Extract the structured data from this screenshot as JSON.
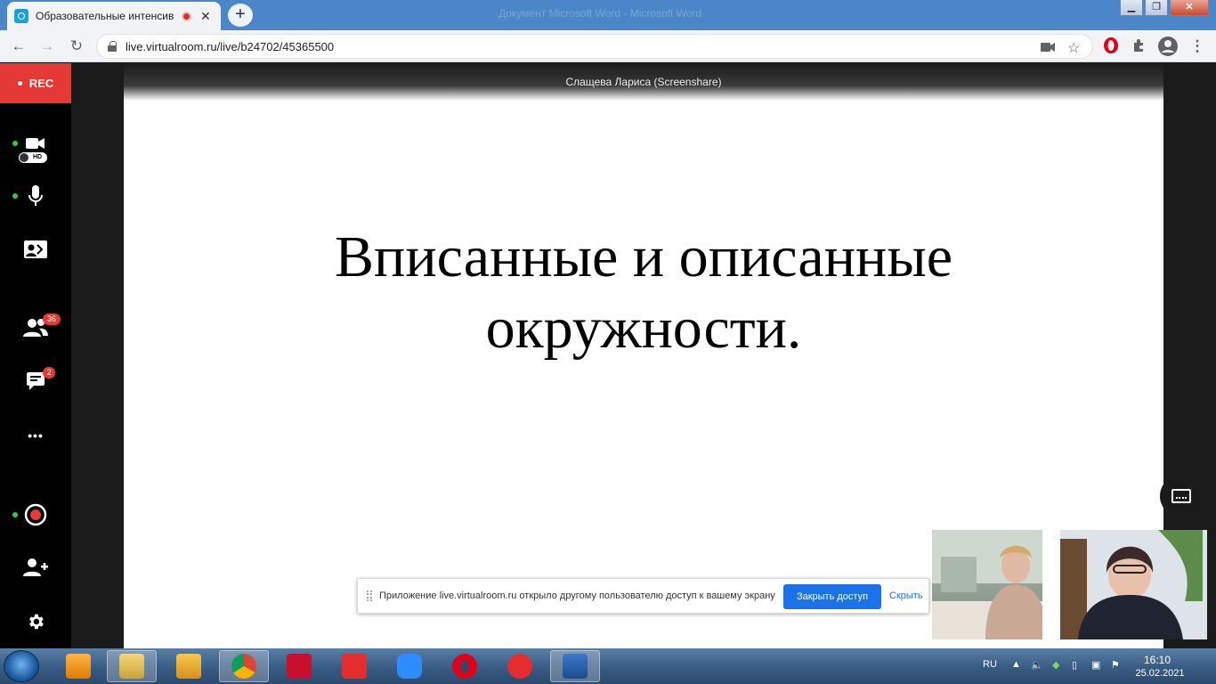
{
  "browser": {
    "tab_title": "Образовательные интенсив",
    "new_tab": "+",
    "url": "live.virtualroom.ru/live/b24702/45365500",
    "window_title": "Документ Microsoft Word - Microsoft Word"
  },
  "sidebar": {
    "rec_label": "REC",
    "camera_quality": "HD",
    "participants_count": "36",
    "chat_count": "2",
    "more_label": "•••"
  },
  "screenshare": {
    "presenter_name": "Слащева Лариса (Screenshare)",
    "slide_line1": "Вписанные и описанные",
    "slide_line2": "окружности."
  },
  "share_notice": {
    "text": "Приложение live.virtualroom.ru открыло другому пользователю доступ к вашему экрану",
    "stop_button": "Закрыть доступ",
    "hide_link": "Скрыть"
  },
  "taskbar": {
    "language": "RU",
    "time": "16:10",
    "date": "25.02.2021"
  },
  "colors": {
    "rec_red": "#e53935",
    "accent_blue": "#1a73e8",
    "status_green": "#2ecc40"
  }
}
